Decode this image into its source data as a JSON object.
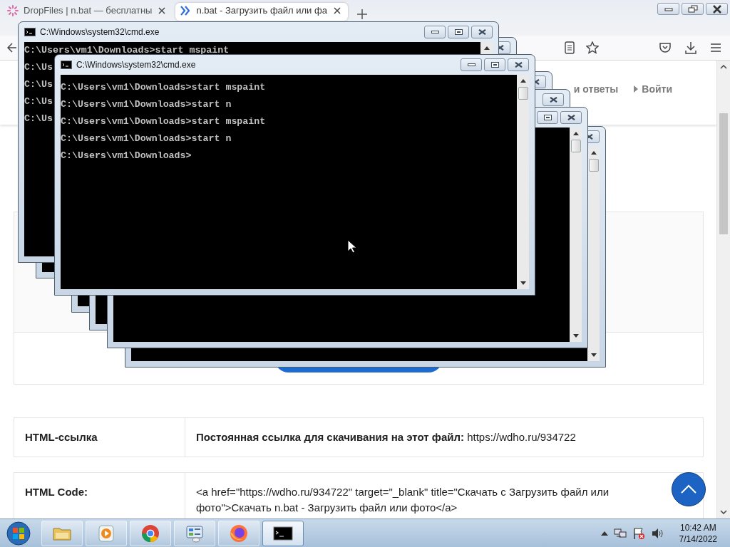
{
  "browser": {
    "tabs": [
      {
        "title": "DropFiles | n.bat — бесплатны",
        "selected": false,
        "kind": "loading"
      },
      {
        "title": "n.bat - Загрузить файл или фа",
        "selected": true,
        "kind": "site"
      }
    ]
  },
  "page": {
    "nav": [
      {
        "text": "и ответы",
        "kind": "plain"
      },
      {
        "text": "Войти",
        "kind": "caret"
      }
    ],
    "table": {
      "rows": [
        {
          "label": "HTML-ссылка",
          "value": "**Постоянная ссылка для скачивания на этот файл:** https://wdho.ru/934722"
        },
        {
          "label": "HTML Code:",
          "value": "<a href=\"https://wdho.ru/934722\" target=\"_blank\" title=\"Скачать с Загрузить файл или фото\">Скачать n.bat - Загрузить файл или фото</a>"
        }
      ]
    }
  },
  "console_windows": [
    {
      "kind": "console",
      "title": "C:\\Windows\\system32\\cmd.exe",
      "lines": [
        "C:\\Users\\vm1\\Downloads>start mspaint",
        "C:\\Us",
        "C:\\Us",
        "C:\\Us",
        "C:\\Us"
      ]
    },
    {
      "kind": "console"
    },
    {
      "kind": "console",
      "title": "C:\\Windows\\system32\\cmd.exe",
      "lines": [
        "C:\\Users\\vm1\\Downloads>start mspaint",
        "C:\\Users\\vm1\\Downloads>start n",
        "C:\\Users\\vm1\\Downloads>start mspaint",
        "C:\\Users\\vm1\\Downloads>start n",
        "C:\\Users\\vm1\\Downloads>"
      ]
    },
    {
      "kind": "console"
    },
    {
      "kind": "console"
    },
    {
      "kind": "console"
    },
    {
      "kind": "console"
    }
  ],
  "taskbar": {
    "apps": [
      {
        "kind": "explorer",
        "selected": false
      },
      {
        "kind": "media",
        "selected": false
      },
      {
        "kind": "chrome",
        "selected": false
      },
      {
        "kind": "control",
        "selected": false
      },
      {
        "kind": "firefox",
        "selected": false
      },
      {
        "kind": "console",
        "selected": true
      }
    ],
    "clock": {
      "time": "10:42 AM",
      "date": "7/14/2022"
    }
  }
}
